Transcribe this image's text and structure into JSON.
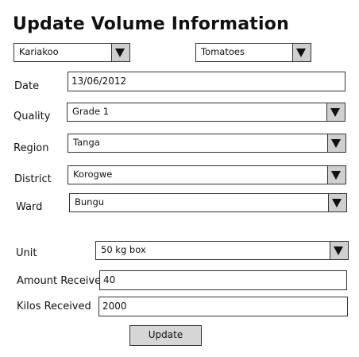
{
  "page": {
    "title": "Update Volume Information"
  },
  "market_select": {
    "value": "Kariakoo"
  },
  "commodity_select": {
    "value": "Tomatoes"
  },
  "form": {
    "date": {
      "label": "Date",
      "value": "13/06/2012"
    },
    "quality": {
      "label": "Quality",
      "value": "Grade 1"
    },
    "region": {
      "label": "Region",
      "value": "Tanga"
    },
    "district": {
      "label": "District",
      "value": "Korogwe"
    },
    "ward": {
      "label": "Ward",
      "value": "Bungu"
    },
    "unit": {
      "label": "Unit",
      "value": "50 kg box"
    },
    "amount_received": {
      "label": "Amount Received",
      "value": "40"
    },
    "kilos_received": {
      "label": "Kilos Received",
      "value": "2000"
    }
  },
  "actions": {
    "update_label": "Update"
  },
  "icons": {
    "dropdown_arrow": "triangle-down-icon"
  }
}
